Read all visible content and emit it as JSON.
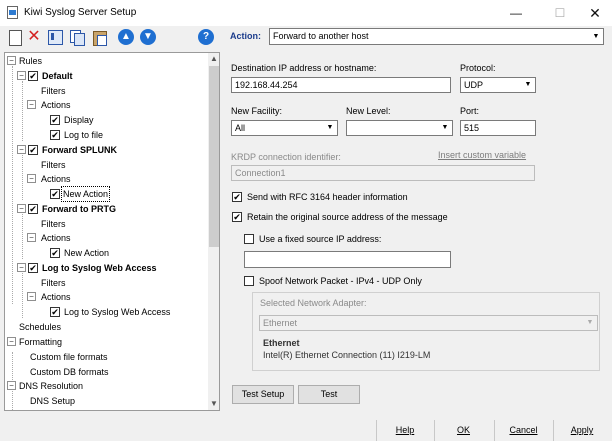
{
  "window": {
    "title": "Kiwi Syslog Server Setup"
  },
  "toolbar": {
    "action_label": "Action:",
    "action_value": "Forward to another host",
    "up_glyph": "▲",
    "down_glyph": "▼",
    "help_glyph": "?",
    "delete_glyph": "✕"
  },
  "tree": {
    "rules": "Rules",
    "rule1": "Default",
    "filters": "Filters",
    "actions": "Actions",
    "display": "Display",
    "log_to_file": "Log to file",
    "rule2": "Forward SPLUNK",
    "new_action": "New Action",
    "rule3": "Forward to PRTG",
    "rule4": "Log to Syslog Web Access",
    "log_web": "Log to Syslog Web Access",
    "schedules": "Schedules",
    "formatting": "Formatting",
    "custom_file": "Custom file formats",
    "custom_db": "Custom DB formats",
    "dns_resolution": "DNS Resolution",
    "dns_setup": "DNS Setup",
    "expand_minus": "−",
    "check": "✔"
  },
  "form": {
    "dest_label": "Destination IP address or hostname:",
    "dest_value": "192.168.44.254",
    "protocol_label": "Protocol:",
    "protocol_value": "UDP",
    "facility_label": "New Facility:",
    "facility_value": "All",
    "level_label": "New Level:",
    "level_value": "",
    "port_label": "Port:",
    "port_value": "515",
    "krdp_label": "KRDP connection identifier:",
    "krdp_value": "Connection1",
    "insert_link": "Insert custom variable",
    "rfc_label": "Send with RFC 3164 header information",
    "rfc_checked": true,
    "retain_label": "Retain the original source address of the message",
    "retain_checked": true,
    "fixed_ip_label": "Use a fixed source IP address:",
    "fixed_ip_checked": false,
    "fixed_ip_value": "",
    "spoof_label": "Spoof Network Packet - IPv4 - UDP Only",
    "spoof_checked": false,
    "adapter_label": "Selected Network Adapter:",
    "adapter_value": "Ethernet",
    "adapter_name": "Ethernet",
    "adapter_desc": "Intel(R) Ethernet Connection (11) I219-LM",
    "test_setup": "Test Setup",
    "test": "Test"
  },
  "footer": {
    "help": "Help",
    "ok": "OK",
    "cancel": "Cancel",
    "apply": "Apply"
  }
}
